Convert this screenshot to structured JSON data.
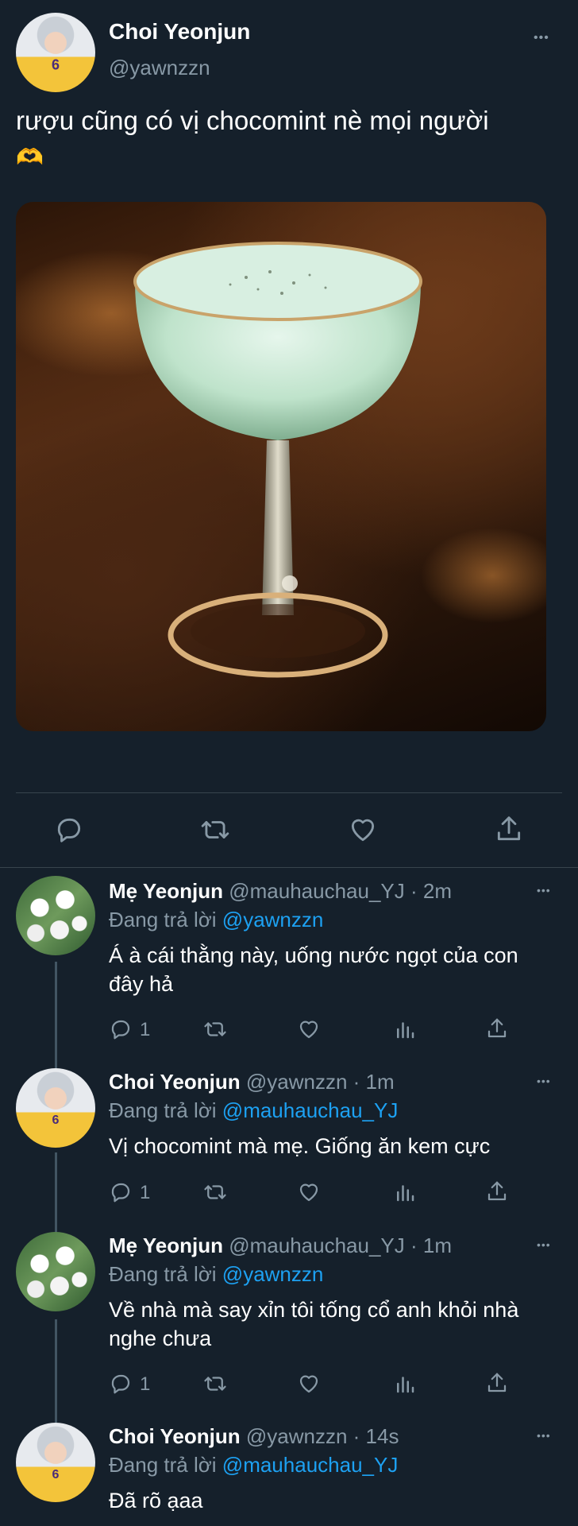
{
  "main_tweet": {
    "author_name": "Choi Yeonjun",
    "author_handle": "@yawnzzn",
    "text": "rượu cũng có vị chocomint nè mọi người",
    "emoji": "🫶",
    "avatar_jersey": "6"
  },
  "icons": {
    "reply": "reply-icon",
    "retweet": "retweet-icon",
    "like": "heart-icon",
    "share": "share-icon",
    "analytics": "analytics-icon",
    "more": "more-icon"
  },
  "more_label": "•••",
  "colors": {
    "background": "#15202b",
    "secondary_text": "#8899a6",
    "mention": "#1da1f2",
    "divider": "#38444d"
  },
  "replies": [
    {
      "author_name": "Mẹ Yeonjun",
      "author_handle": "@mauhauchau_YJ",
      "time": "· 2m",
      "replying_prefix": "Đang trả lời",
      "replying_to": "@yawnzzn",
      "text": "Á à cái thằng này, uống nước ngọt của con đây hả",
      "reply_count": "1"
    },
    {
      "author_name": "Choi Yeonjun",
      "author_handle": "@yawnzzn",
      "time": "· 1m",
      "replying_prefix": "Đang trả lời",
      "replying_to": "@mauhauchau_YJ",
      "text": "Vị chocomint mà mẹ. Giống ăn kem cực",
      "reply_count": "1"
    },
    {
      "author_name": "Mẹ Yeonjun",
      "author_handle": "@mauhauchau_YJ",
      "time": "· 1m",
      "replying_prefix": "Đang trả lời",
      "replying_to": "@yawnzzn",
      "text": "Về nhà mà say xỉn tôi tống cổ anh khỏi nhà nghe chưa",
      "reply_count": "1"
    },
    {
      "author_name": "Choi Yeonjun",
      "author_handle": "@yawnzzn",
      "time": "· 14s",
      "replying_prefix": "Đang trả lời",
      "replying_to": "@mauhauchau_YJ",
      "text": "Đã rõ ạaa"
    }
  ]
}
